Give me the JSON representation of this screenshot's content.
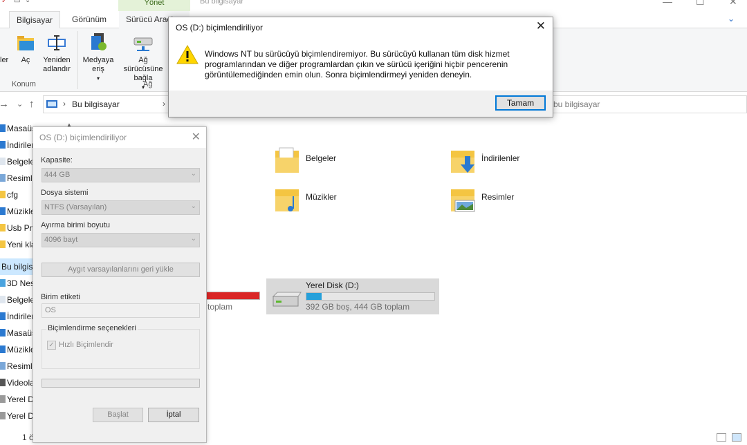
{
  "explorer": {
    "title": "Bu bilgisayar",
    "manage_tab": "Yönet",
    "ribbon_tabs": {
      "bilgisayar": "Bilgisayar",
      "gorunum": "Görünüm",
      "surucu": "Sürücü Araçları"
    },
    "ribbon": {
      "ozellikler": "ler",
      "ac": "Aç",
      "yeniden_adlandir": "Yeniden adlandır",
      "medyaya_eris": "Medyaya eriş",
      "ag_surucusune_bagla": "Ağ sürücüsüne bağla",
      "ag_konumu": "Ağ",
      "group_konum": "Konum",
      "group_ag": "Ağ"
    },
    "address": {
      "crumb": "Bu bilgisayar"
    },
    "search_placeholder": "bu bilgisayar",
    "nav_items": [
      "Masaüstü",
      "İndirilenler",
      "Belgeler",
      "Resimler",
      "cfg",
      "Müzikler",
      "Usb Pnp",
      "Yeni klasör",
      "Bu bilgisayar",
      "3D Nesneler",
      "Belgeler",
      "İndirilenler",
      "Masaüstü",
      "Müzikler",
      "Resimler",
      "Videolar",
      "Yerel Disk",
      "Yerel Disk"
    ],
    "folders": {
      "belgeler": "Belgeler",
      "indirilenler": "İndirilenler",
      "muzikler": "Müzikler",
      "resimler": "Resimler"
    },
    "drive_c": {
      "info": "toplam",
      "fill": 0.95
    },
    "drive_d": {
      "name": "Yerel Disk (D:)",
      "info": "392 GB boş, 444 GB toplam",
      "fill": 0.12
    },
    "status": "1 öğe"
  },
  "format_dialog": {
    "title": "OS (D:) biçimlendiriliyor",
    "capacity_label": "Kapasite:",
    "capacity_value": "444 GB",
    "filesystem_label": "Dosya sistemi",
    "filesystem_value": "NTFS (Varsayılan)",
    "allocation_label": "Ayırma birimi boyutu",
    "allocation_value": "4096 bayt",
    "restore_defaults": "Aygıt varsayılanlarını geri yükle",
    "volume_label_label": "Birim etiketi",
    "volume_label_value": "OS",
    "options_label": "Biçimlendirme seçenekleri",
    "quick_format": "Hızlı Biçimlendir",
    "start": "Başlat",
    "cancel": "İptal"
  },
  "message_box": {
    "title": "OS (D:) biçimlendiriliyor",
    "text": "Windows NT bu sürücüyü biçimlendiremiyor.  Bu sürücüyü kullanan tüm disk hizmet programlarından ve diğer programlardan çıkın ve sürücü içeriğini hiçbir pencerenin görüntülemediğinden emin olun. Sonra biçimlendirmeyi yeniden deneyin.",
    "ok": "Tamam"
  }
}
